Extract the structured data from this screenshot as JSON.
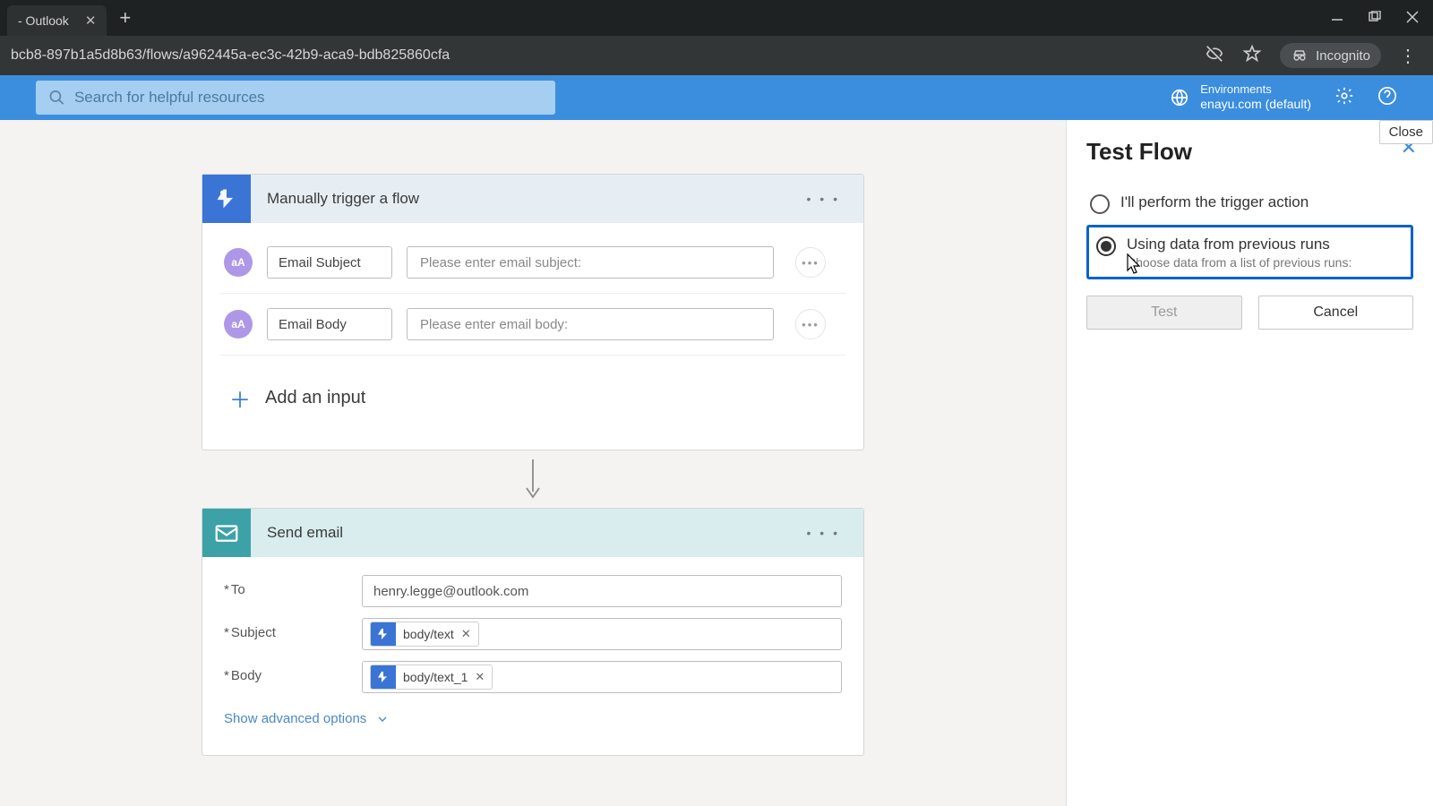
{
  "browser": {
    "tab_title": "- Outlook",
    "url": "bcb8-897b1a5d8b63/flows/a962445a-ec3c-42b9-aca9-bdb825860cfa",
    "incognito": "Incognito"
  },
  "header": {
    "search_placeholder": "Search for helpful resources",
    "env_label": "Environments",
    "env_value": "enayu.com (default)",
    "close_tooltip": "Close"
  },
  "trigger_card": {
    "title": "Manually trigger a flow",
    "param1_name": "Email Subject",
    "param1_placeholder": "Please enter email subject:",
    "param2_name": "Email Body",
    "param2_placeholder": "Please enter email body:",
    "add_input": "Add an input"
  },
  "action_card": {
    "title": "Send email",
    "to_label": "To",
    "to_value": "henry.legge@outlook.com",
    "subject_label": "Subject",
    "subject_token": "body/text",
    "body_label": "Body",
    "body_token": "body/text_1",
    "adv": "Show advanced options"
  },
  "panel": {
    "title": "Test Flow",
    "opt1": "I'll perform the trigger action",
    "opt2": "Using data from previous runs",
    "opt2_sub": "Choose data from a list of previous runs:",
    "test": "Test",
    "cancel": "Cancel"
  },
  "badge": "aA"
}
